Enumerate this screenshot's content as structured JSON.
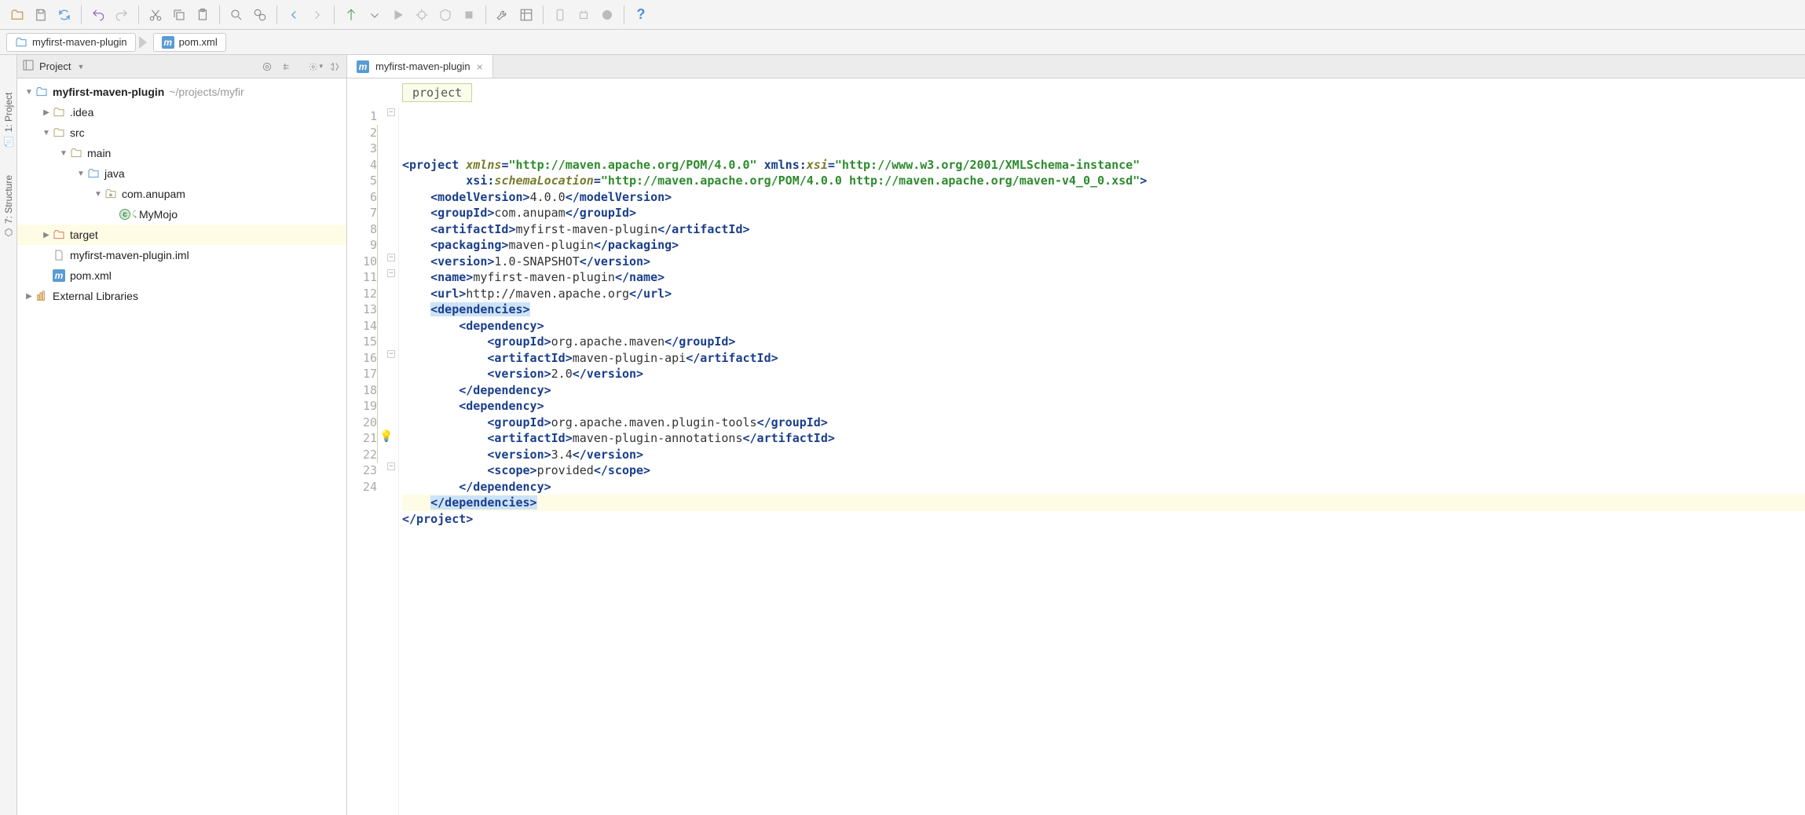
{
  "breadcrumb": [
    {
      "icon": "folder",
      "label": "myfirst-maven-plugin"
    },
    {
      "icon": "m",
      "label": "pom.xml"
    }
  ],
  "leftTabs": [
    "1: Project",
    "7: Structure"
  ],
  "projectPanel": {
    "title": "Project"
  },
  "tree": [
    {
      "indent": 0,
      "arrow": "down",
      "icon": "folder-blue",
      "label": "myfirst-maven-plugin",
      "path": "~/projects/myfir"
    },
    {
      "indent": 1,
      "arrow": "right",
      "icon": "folder",
      "label": ".idea"
    },
    {
      "indent": 1,
      "arrow": "down",
      "icon": "folder",
      "label": "src"
    },
    {
      "indent": 2,
      "arrow": "down",
      "icon": "folder",
      "label": "main"
    },
    {
      "indent": 3,
      "arrow": "down",
      "icon": "folder-src",
      "label": "java"
    },
    {
      "indent": 4,
      "arrow": "down",
      "icon": "package",
      "label": "com.anupam"
    },
    {
      "indent": 5,
      "arrow": "",
      "icon": "class",
      "label": "MyMojo"
    },
    {
      "indent": 1,
      "arrow": "right",
      "icon": "folder-red",
      "label": "target",
      "hl": true
    },
    {
      "indent": 1,
      "arrow": "",
      "icon": "file",
      "label": "myfirst-maven-plugin.iml"
    },
    {
      "indent": 1,
      "arrow": "",
      "icon": "m",
      "label": "pom.xml"
    },
    {
      "indent": 0,
      "arrow": "right",
      "icon": "lib",
      "label": "External Libraries"
    }
  ],
  "editor": {
    "tabLabel": "myfirst-maven-plugin",
    "crumb": "project",
    "lines": [
      {
        "n": 1,
        "segs": [
          {
            "t": "<",
            "c": "t-tag"
          },
          {
            "t": "project ",
            "c": "t-tag"
          },
          {
            "t": "xmlns",
            "c": "t-attrns"
          },
          {
            "t": "=",
            "c": "t-attr"
          },
          {
            "t": "\"http://maven.apache.org/POM/4.0.0\"",
            "c": "t-str"
          },
          {
            "t": " ",
            "c": ""
          },
          {
            "t": "xmlns:",
            "c": "t-attr"
          },
          {
            "t": "xsi",
            "c": "t-attrns"
          },
          {
            "t": "=",
            "c": "t-attr"
          },
          {
            "t": "\"http://www.w3.org/2001/XMLSchema-instance\"",
            "c": "t-str"
          }
        ]
      },
      {
        "n": 2,
        "segs": [
          {
            "t": "         ",
            "c": ""
          },
          {
            "t": "xsi:",
            "c": "t-attr"
          },
          {
            "t": "schemaLocation",
            "c": "t-attrns"
          },
          {
            "t": "=",
            "c": "t-attr"
          },
          {
            "t": "\"http://maven.apache.org/POM/4.0.0 http://maven.apache.org/maven-v4_0_0.xsd\"",
            "c": "t-str"
          },
          {
            "t": ">",
            "c": "t-tag"
          }
        ]
      },
      {
        "n": 3,
        "segs": [
          {
            "t": "    ",
            "c": ""
          },
          {
            "t": "<modelVersion>",
            "c": "t-tag"
          },
          {
            "t": "4.0.0",
            "c": "t-txt"
          },
          {
            "t": "</modelVersion>",
            "c": "t-tag"
          }
        ]
      },
      {
        "n": 4,
        "segs": [
          {
            "t": "    ",
            "c": ""
          },
          {
            "t": "<groupId>",
            "c": "t-tag"
          },
          {
            "t": "com.anupam",
            "c": "t-txt"
          },
          {
            "t": "</groupId>",
            "c": "t-tag"
          }
        ]
      },
      {
        "n": 5,
        "segs": [
          {
            "t": "    ",
            "c": ""
          },
          {
            "t": "<artifactId>",
            "c": "t-tag"
          },
          {
            "t": "myfirst-maven-plugin",
            "c": "t-txt"
          },
          {
            "t": "</artifactId>",
            "c": "t-tag"
          }
        ]
      },
      {
        "n": 6,
        "segs": [
          {
            "t": "    ",
            "c": ""
          },
          {
            "t": "<packaging>",
            "c": "t-tag"
          },
          {
            "t": "maven-plugin",
            "c": "t-txt"
          },
          {
            "t": "</packaging>",
            "c": "t-tag"
          }
        ]
      },
      {
        "n": 7,
        "segs": [
          {
            "t": "    ",
            "c": ""
          },
          {
            "t": "<version>",
            "c": "t-tag"
          },
          {
            "t": "1.0-SNAPSHOT",
            "c": "t-txt"
          },
          {
            "t": "</version>",
            "c": "t-tag"
          }
        ]
      },
      {
        "n": 8,
        "segs": [
          {
            "t": "    ",
            "c": ""
          },
          {
            "t": "<name>",
            "c": "t-tag"
          },
          {
            "t": "myfirst-maven-plugin",
            "c": "t-txt"
          },
          {
            "t": "</name>",
            "c": "t-tag"
          }
        ]
      },
      {
        "n": 9,
        "segs": [
          {
            "t": "    ",
            "c": ""
          },
          {
            "t": "<url>",
            "c": "t-tag"
          },
          {
            "t": "http://maven.apache.org",
            "c": "t-txt"
          },
          {
            "t": "</url>",
            "c": "t-tag"
          }
        ]
      },
      {
        "n": 10,
        "segs": [
          {
            "t": "    ",
            "c": ""
          },
          {
            "t": "<dependencies>",
            "c": "t-tag",
            "hl": true
          }
        ]
      },
      {
        "n": 11,
        "segs": [
          {
            "t": "        ",
            "c": ""
          },
          {
            "t": "<dependency>",
            "c": "t-tag"
          }
        ]
      },
      {
        "n": 12,
        "segs": [
          {
            "t": "            ",
            "c": ""
          },
          {
            "t": "<groupId>",
            "c": "t-tag"
          },
          {
            "t": "org.apache.maven",
            "c": "t-txt"
          },
          {
            "t": "</groupId>",
            "c": "t-tag"
          }
        ]
      },
      {
        "n": 13,
        "segs": [
          {
            "t": "            ",
            "c": ""
          },
          {
            "t": "<artifactId>",
            "c": "t-tag"
          },
          {
            "t": "maven-plugin-api",
            "c": "t-txt"
          },
          {
            "t": "</artifactId>",
            "c": "t-tag"
          }
        ]
      },
      {
        "n": 14,
        "segs": [
          {
            "t": "            ",
            "c": ""
          },
          {
            "t": "<version>",
            "c": "t-tag"
          },
          {
            "t": "2.0",
            "c": "t-txt"
          },
          {
            "t": "</version>",
            "c": "t-tag"
          }
        ]
      },
      {
        "n": 15,
        "segs": [
          {
            "t": "        ",
            "c": ""
          },
          {
            "t": "</dependency>",
            "c": "t-tag"
          }
        ]
      },
      {
        "n": 16,
        "segs": [
          {
            "t": "        ",
            "c": ""
          },
          {
            "t": "<dependency>",
            "c": "t-tag"
          }
        ]
      },
      {
        "n": 17,
        "segs": [
          {
            "t": "            ",
            "c": ""
          },
          {
            "t": "<groupId>",
            "c": "t-tag"
          },
          {
            "t": "org.apache.maven.plugin-tools",
            "c": "t-txt"
          },
          {
            "t": "</groupId>",
            "c": "t-tag"
          }
        ]
      },
      {
        "n": 18,
        "segs": [
          {
            "t": "            ",
            "c": ""
          },
          {
            "t": "<artifactId>",
            "c": "t-tag"
          },
          {
            "t": "maven-plugin-annotations",
            "c": "t-txt"
          },
          {
            "t": "</artifactId>",
            "c": "t-tag"
          }
        ]
      },
      {
        "n": 19,
        "segs": [
          {
            "t": "            ",
            "c": ""
          },
          {
            "t": "<version>",
            "c": "t-tag"
          },
          {
            "t": "3.4",
            "c": "t-txt"
          },
          {
            "t": "</version>",
            "c": "t-tag"
          }
        ]
      },
      {
        "n": 20,
        "segs": [
          {
            "t": "            ",
            "c": ""
          },
          {
            "t": "<scope>",
            "c": "t-tag"
          },
          {
            "t": "provided",
            "c": "t-txt"
          },
          {
            "t": "</scope>",
            "c": "t-tag"
          }
        ]
      },
      {
        "n": 21,
        "segs": [
          {
            "t": "        ",
            "c": ""
          },
          {
            "t": "</dependency>",
            "c": "t-tag"
          }
        ]
      },
      {
        "n": 22,
        "segs": [
          {
            "t": "    ",
            "c": ""
          },
          {
            "t": "</dependencies>",
            "c": "t-tag",
            "hl": true
          }
        ],
        "cursor": true
      },
      {
        "n": 23,
        "segs": [
          {
            "t": "</project>",
            "c": "t-tag"
          }
        ]
      },
      {
        "n": 24,
        "segs": [
          {
            "t": "",
            "c": ""
          }
        ]
      }
    ]
  }
}
